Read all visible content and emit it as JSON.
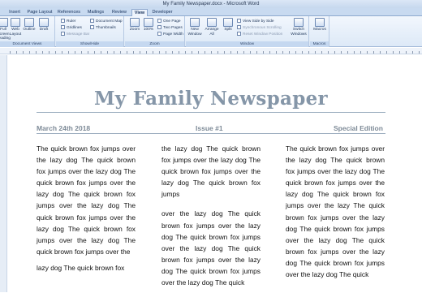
{
  "window": {
    "title": "My Family Newspaper.docx - Microsoft Word"
  },
  "tabs": [
    "Insert",
    "Page Layout",
    "References",
    "Mailings",
    "Review",
    "View",
    "Developer"
  ],
  "ribbon": {
    "document_views": {
      "label": "Document Views",
      "buttons": [
        "Full Screen Reading",
        "Web Layout",
        "Outline",
        "Draft"
      ]
    },
    "show_hide": {
      "label": "Show/Hide",
      "ruler": "Ruler",
      "gridlines": "Gridlines",
      "message_bar": "Message Bar",
      "document_map": "Document Map",
      "thumbnails": "Thumbnails"
    },
    "zoom": {
      "label": "Zoom",
      "zoom_btn": "Zoom",
      "hundred_btn": "100%",
      "one_page": "One Page",
      "two_pages": "Two Pages",
      "page_width": "Page Width"
    },
    "window": {
      "label": "Window",
      "new_window": "New Window",
      "arrange_all": "Arrange All",
      "split": "Split",
      "side_by_side": "View Side by Side",
      "sync_scroll": "Synchronous Scrolling",
      "reset_position": "Reset Window Position",
      "switch_windows": "Switch Windows"
    },
    "macros": {
      "label": "Macros",
      "button": "Macros"
    }
  },
  "document": {
    "masthead": "My Family Newspaper",
    "date": "March 24th 2018",
    "issue": "Issue #1",
    "edition": "Special Edition",
    "columns": [
      [
        "The quick brown fox jumps over the lazy dog The quick brown fox jumps over the lazy dog The quick brown fox jumps over the lazy dog The quick brown fox jumps over the lazy dog The quick brown fox jumps over the lazy dog The quick brown fox jumps over the lazy dog The quick brown fox jumps over the",
        "lazy dog The quick brown fox"
      ],
      [
        "the lazy dog The quick brown fox jumps over the lazy dog The quick brown fox jumps over the lazy dog The quick brown fox jumps",
        "over the lazy dog The quick brown fox jumps over the lazy dog The quick brown fox jumps over the lazy dog The quick brown fox jumps over the lazy dog The quick brown fox jumps over the lazy dog The quick"
      ],
      [
        "The quick brown fox jumps over the lazy dog The quick brown fox jumps over the lazy dog The quick brown fox jumps over the lazy dog The quick brown fox jumps over the lazy The quick brown fox jumps over the lazy dog The quick brown fox jumps over the lazy dog The quick brown fox jumps over the lazy dog The quick brown fox jumps over the lazy dog The quick"
      ]
    ]
  },
  "colors": {
    "masthead": "#8596a8",
    "ribbon_top": "#f2f7fd",
    "tab_strip": "#c8daf0"
  }
}
